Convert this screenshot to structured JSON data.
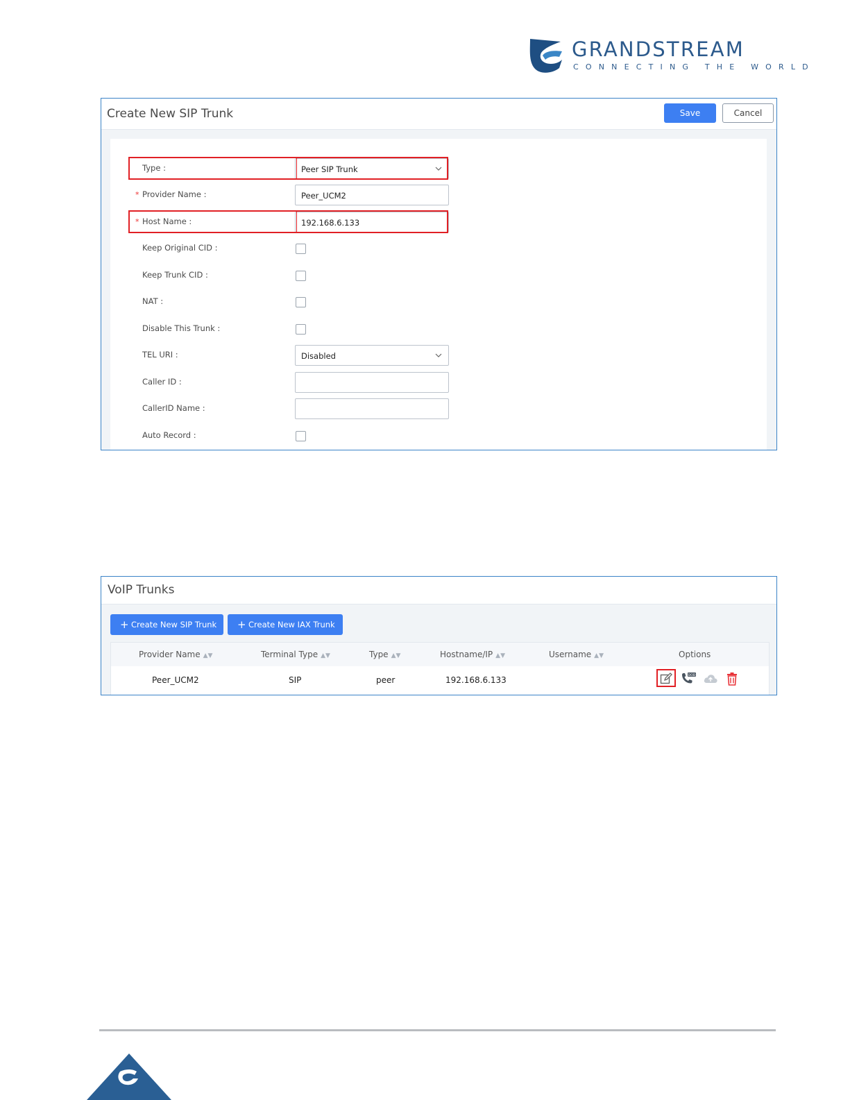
{
  "brand": {
    "name": "GRANDSTREAM",
    "tagline": "CONNECTING THE WORLD",
    "color": "#2c5a8c"
  },
  "create_trunk": {
    "title": "Create New SIP Trunk",
    "save_label": "Save",
    "cancel_label": "Cancel",
    "fields": {
      "type": {
        "label": "Type",
        "value": "Peer SIP Trunk"
      },
      "provider_name": {
        "label": "Provider Name",
        "value": "Peer_UCM2",
        "required": true
      },
      "host_name": {
        "label": "Host Name",
        "value": "192.168.6.133",
        "required": true
      },
      "keep_original_cid": {
        "label": "Keep Original CID",
        "checked": false
      },
      "keep_trunk_cid": {
        "label": "Keep Trunk CID",
        "checked": false
      },
      "nat": {
        "label": "NAT",
        "checked": false
      },
      "disable_trunk": {
        "label": "Disable This Trunk",
        "checked": false
      },
      "tel_uri": {
        "label": "TEL URI",
        "value": "Disabled"
      },
      "caller_id": {
        "label": "Caller ID",
        "value": ""
      },
      "caller_id_name": {
        "label": "CallerID Name",
        "value": ""
      },
      "auto_record": {
        "label": "Auto Record",
        "checked": false
      }
    }
  },
  "voip_trunks": {
    "title": "VoIP Trunks",
    "create_sip_label": "Create New SIP Trunk",
    "create_iax_label": "Create New IAX Trunk",
    "columns": [
      "Provider Name",
      "Terminal Type",
      "Type",
      "Hostname/IP",
      "Username",
      "Options"
    ],
    "rows": [
      {
        "provider_name": "Peer_UCM2",
        "terminal_type": "SIP",
        "type": "peer",
        "hostname": "192.168.6.133",
        "username": ""
      }
    ],
    "option_icons": [
      "edit-icon",
      "dod-phone-icon",
      "cloud-upload-icon",
      "trash-icon"
    ]
  },
  "colors": {
    "accent": "#3d7ff2",
    "highlight": "#e12025",
    "panel_border": "#3b83c7"
  }
}
